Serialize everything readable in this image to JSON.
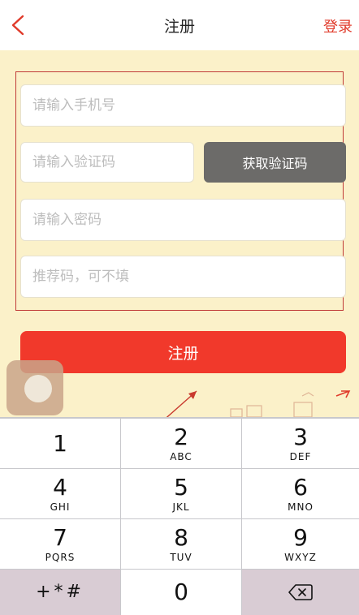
{
  "nav": {
    "title": "注册",
    "login_label": "登录",
    "back_icon": "chevron-left-icon",
    "accent_color": "#e03a2a"
  },
  "form": {
    "phone_placeholder": "请输入手机号",
    "code_placeholder": "请输入验证码",
    "get_code_label": "获取验证码",
    "password_placeholder": "请输入密码",
    "referral_placeholder": "推荐码，可不填",
    "register_label": "注册",
    "register_color": "#f1392b"
  },
  "keyboard": {
    "keys": [
      {
        "num": "1",
        "sub": ""
      },
      {
        "num": "2",
        "sub": "ABC"
      },
      {
        "num": "3",
        "sub": "DEF"
      },
      {
        "num": "4",
        "sub": "GHI"
      },
      {
        "num": "5",
        "sub": "JKL"
      },
      {
        "num": "6",
        "sub": "MNO"
      },
      {
        "num": "7",
        "sub": "PQRS"
      },
      {
        "num": "8",
        "sub": "TUV"
      },
      {
        "num": "9",
        "sub": "WXYZ"
      },
      {
        "num": "+*#",
        "sub": ""
      },
      {
        "num": "0",
        "sub": ""
      },
      {
        "num": "",
        "sub": "",
        "icon": "backspace-icon"
      }
    ]
  }
}
